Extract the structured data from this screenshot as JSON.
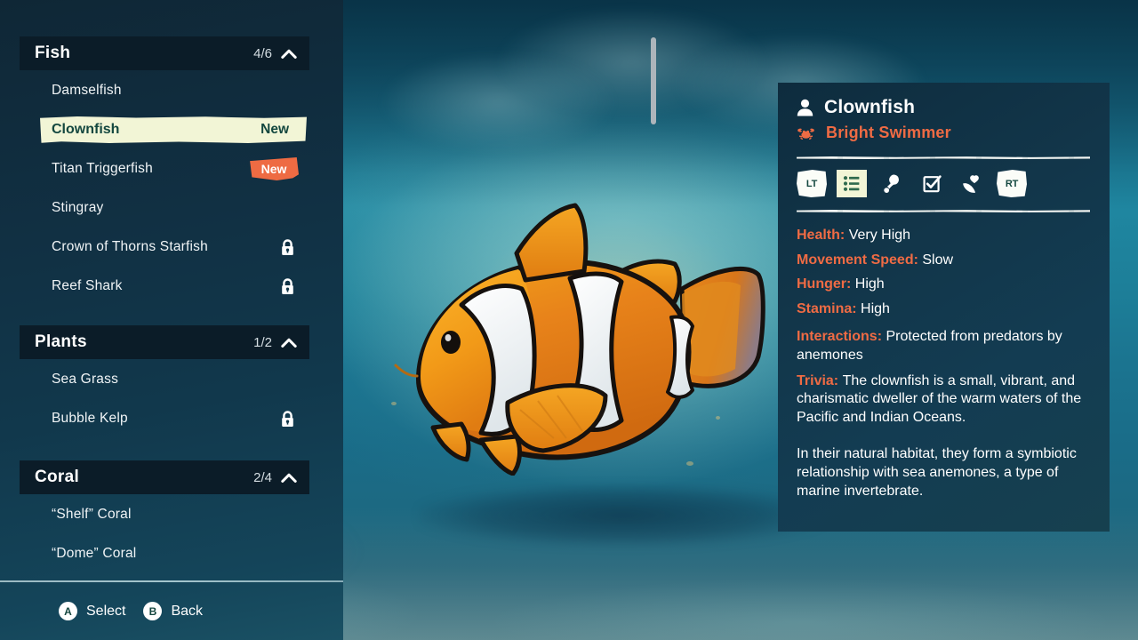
{
  "sidebar": {
    "categories": [
      {
        "name": "Fish",
        "count": "4/6",
        "collapse_icon": "chevron-up-icon",
        "items": [
          {
            "label": "Damselfish",
            "state": "unlocked",
            "badge": ""
          },
          {
            "label": "Clownfish",
            "state": "selected",
            "badge": "New"
          },
          {
            "label": "Titan Triggerfish",
            "state": "unlocked",
            "badge": "New"
          },
          {
            "label": "Stingray",
            "state": "unlocked",
            "badge": ""
          },
          {
            "label": "Crown of Thorns Starfish",
            "state": "locked",
            "badge": ""
          },
          {
            "label": "Reef Shark",
            "state": "locked",
            "badge": ""
          }
        ]
      },
      {
        "name": "Plants",
        "count": "1/2",
        "collapse_icon": "chevron-up-icon",
        "items": [
          {
            "label": "Sea Grass",
            "state": "unlocked",
            "badge": ""
          },
          {
            "label": "Bubble Kelp",
            "state": "locked",
            "badge": ""
          }
        ]
      },
      {
        "name": "Coral",
        "count": "2/4",
        "collapse_icon": "chevron-up-icon",
        "items": [
          {
            "label": "“Shelf” Coral",
            "state": "unlocked",
            "badge": ""
          },
          {
            "label": "“Dome” Coral",
            "state": "unlocked",
            "badge": ""
          }
        ]
      }
    ]
  },
  "prompts": [
    {
      "button": "A",
      "label": "Select"
    },
    {
      "button": "B",
      "label": "Back"
    }
  ],
  "panel": {
    "title": "Clownfish",
    "title_icon": "person-icon",
    "subtitle": "Bright Swimmer",
    "subtitle_icon": "crab-icon",
    "tabs": [
      {
        "id": "lt-bumper",
        "icon": "lt-shoulder-button-icon",
        "text": "LT",
        "selected": false
      },
      {
        "id": "info",
        "icon": "list-icon",
        "text": "",
        "selected": true
      },
      {
        "id": "food",
        "icon": "food-drumstick-icon",
        "text": "",
        "selected": false
      },
      {
        "id": "tasks",
        "icon": "checkbox-icon",
        "text": "",
        "selected": false
      },
      {
        "id": "care",
        "icon": "heart-hand-icon",
        "text": "",
        "selected": false
      },
      {
        "id": "rt-bumper",
        "icon": "rt-shoulder-button-icon",
        "text": "RT",
        "selected": false
      }
    ],
    "stats": [
      {
        "key": "Health:",
        "value": "Very High"
      },
      {
        "key": "Movement Speed:",
        "value": "Slow"
      },
      {
        "key": "Hunger:",
        "value": "High"
      },
      {
        "key": "Stamina:",
        "value": "High"
      }
    ],
    "descriptions": [
      {
        "key": "Interactions:",
        "value": "Protected from predators by anemones"
      },
      {
        "key": "Trivia:",
        "value": "The clownfish is a small, vibrant, and charismatic dweller of the warm waters of the Pacific and Indian Oceans."
      }
    ],
    "paragraph": "In their natural habitat, they form a symbiotic relationship with sea anemones, a type of marine invertebrate."
  },
  "colors": {
    "accent_orange": "#ef6b44",
    "selected_cream": "#f2f5d6",
    "panel_bg": "#12364a",
    "sidebar_bg": "#113043",
    "header_bg": "#0b1c28",
    "text_white": "#ffffff",
    "dark_green_text": "#13473f"
  }
}
